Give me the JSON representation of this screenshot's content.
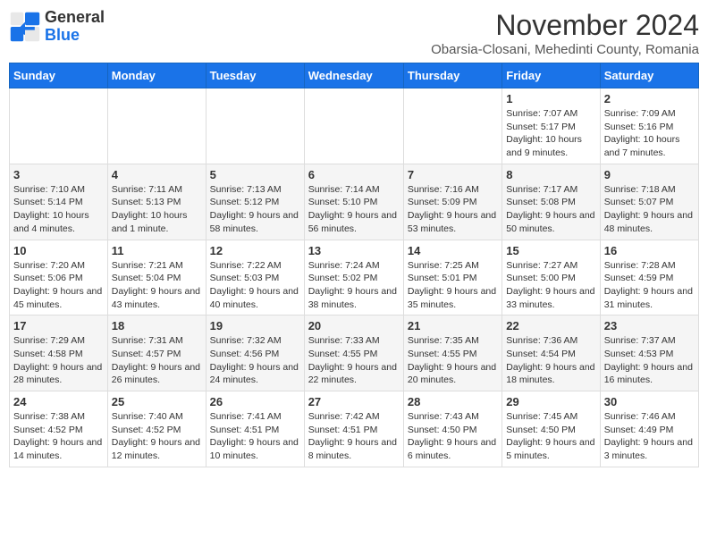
{
  "header": {
    "logo_line1": "General",
    "logo_line2": "Blue",
    "month_title": "November 2024",
    "subtitle": "Obarsia-Closani, Mehedinti County, Romania"
  },
  "days_of_week": [
    "Sunday",
    "Monday",
    "Tuesday",
    "Wednesday",
    "Thursday",
    "Friday",
    "Saturday"
  ],
  "weeks": [
    [
      {
        "day": "",
        "info": ""
      },
      {
        "day": "",
        "info": ""
      },
      {
        "day": "",
        "info": ""
      },
      {
        "day": "",
        "info": ""
      },
      {
        "day": "",
        "info": ""
      },
      {
        "day": "1",
        "info": "Sunrise: 7:07 AM\nSunset: 5:17 PM\nDaylight: 10 hours and 9 minutes."
      },
      {
        "day": "2",
        "info": "Sunrise: 7:09 AM\nSunset: 5:16 PM\nDaylight: 10 hours and 7 minutes."
      }
    ],
    [
      {
        "day": "3",
        "info": "Sunrise: 7:10 AM\nSunset: 5:14 PM\nDaylight: 10 hours and 4 minutes."
      },
      {
        "day": "4",
        "info": "Sunrise: 7:11 AM\nSunset: 5:13 PM\nDaylight: 10 hours and 1 minute."
      },
      {
        "day": "5",
        "info": "Sunrise: 7:13 AM\nSunset: 5:12 PM\nDaylight: 9 hours and 58 minutes."
      },
      {
        "day": "6",
        "info": "Sunrise: 7:14 AM\nSunset: 5:10 PM\nDaylight: 9 hours and 56 minutes."
      },
      {
        "day": "7",
        "info": "Sunrise: 7:16 AM\nSunset: 5:09 PM\nDaylight: 9 hours and 53 minutes."
      },
      {
        "day": "8",
        "info": "Sunrise: 7:17 AM\nSunset: 5:08 PM\nDaylight: 9 hours and 50 minutes."
      },
      {
        "day": "9",
        "info": "Sunrise: 7:18 AM\nSunset: 5:07 PM\nDaylight: 9 hours and 48 minutes."
      }
    ],
    [
      {
        "day": "10",
        "info": "Sunrise: 7:20 AM\nSunset: 5:06 PM\nDaylight: 9 hours and 45 minutes."
      },
      {
        "day": "11",
        "info": "Sunrise: 7:21 AM\nSunset: 5:04 PM\nDaylight: 9 hours and 43 minutes."
      },
      {
        "day": "12",
        "info": "Sunrise: 7:22 AM\nSunset: 5:03 PM\nDaylight: 9 hours and 40 minutes."
      },
      {
        "day": "13",
        "info": "Sunrise: 7:24 AM\nSunset: 5:02 PM\nDaylight: 9 hours and 38 minutes."
      },
      {
        "day": "14",
        "info": "Sunrise: 7:25 AM\nSunset: 5:01 PM\nDaylight: 9 hours and 35 minutes."
      },
      {
        "day": "15",
        "info": "Sunrise: 7:27 AM\nSunset: 5:00 PM\nDaylight: 9 hours and 33 minutes."
      },
      {
        "day": "16",
        "info": "Sunrise: 7:28 AM\nSunset: 4:59 PM\nDaylight: 9 hours and 31 minutes."
      }
    ],
    [
      {
        "day": "17",
        "info": "Sunrise: 7:29 AM\nSunset: 4:58 PM\nDaylight: 9 hours and 28 minutes."
      },
      {
        "day": "18",
        "info": "Sunrise: 7:31 AM\nSunset: 4:57 PM\nDaylight: 9 hours and 26 minutes."
      },
      {
        "day": "19",
        "info": "Sunrise: 7:32 AM\nSunset: 4:56 PM\nDaylight: 9 hours and 24 minutes."
      },
      {
        "day": "20",
        "info": "Sunrise: 7:33 AM\nSunset: 4:55 PM\nDaylight: 9 hours and 22 minutes."
      },
      {
        "day": "21",
        "info": "Sunrise: 7:35 AM\nSunset: 4:55 PM\nDaylight: 9 hours and 20 minutes."
      },
      {
        "day": "22",
        "info": "Sunrise: 7:36 AM\nSunset: 4:54 PM\nDaylight: 9 hours and 18 minutes."
      },
      {
        "day": "23",
        "info": "Sunrise: 7:37 AM\nSunset: 4:53 PM\nDaylight: 9 hours and 16 minutes."
      }
    ],
    [
      {
        "day": "24",
        "info": "Sunrise: 7:38 AM\nSunset: 4:52 PM\nDaylight: 9 hours and 14 minutes."
      },
      {
        "day": "25",
        "info": "Sunrise: 7:40 AM\nSunset: 4:52 PM\nDaylight: 9 hours and 12 minutes."
      },
      {
        "day": "26",
        "info": "Sunrise: 7:41 AM\nSunset: 4:51 PM\nDaylight: 9 hours and 10 minutes."
      },
      {
        "day": "27",
        "info": "Sunrise: 7:42 AM\nSunset: 4:51 PM\nDaylight: 9 hours and 8 minutes."
      },
      {
        "day": "28",
        "info": "Sunrise: 7:43 AM\nSunset: 4:50 PM\nDaylight: 9 hours and 6 minutes."
      },
      {
        "day": "29",
        "info": "Sunrise: 7:45 AM\nSunset: 4:50 PM\nDaylight: 9 hours and 5 minutes."
      },
      {
        "day": "30",
        "info": "Sunrise: 7:46 AM\nSunset: 4:49 PM\nDaylight: 9 hours and 3 minutes."
      }
    ]
  ]
}
